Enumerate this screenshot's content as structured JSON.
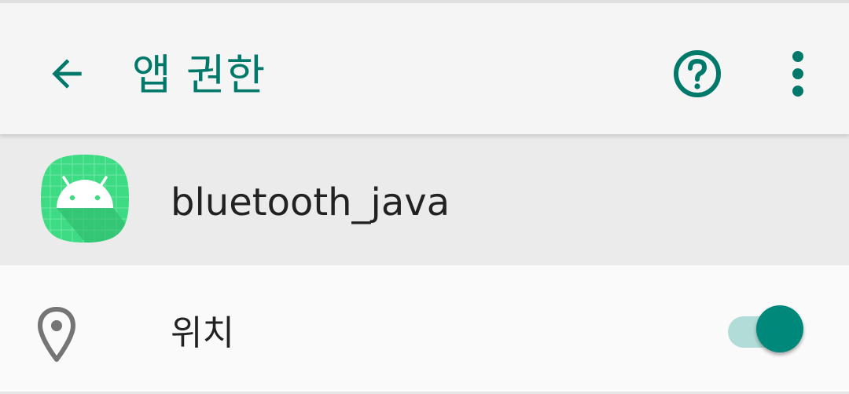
{
  "app_bar": {
    "title": "앱 권한",
    "back_icon": "arrow-back-icon",
    "help_icon": "help-circle-icon",
    "more_icon": "more-vert-icon",
    "accent_color": "#00796b"
  },
  "app_info": {
    "name": "bluetooth_java",
    "icon": "android-app-icon"
  },
  "permissions": [
    {
      "label": "위치",
      "icon": "location-pin-icon",
      "enabled": true
    }
  ]
}
